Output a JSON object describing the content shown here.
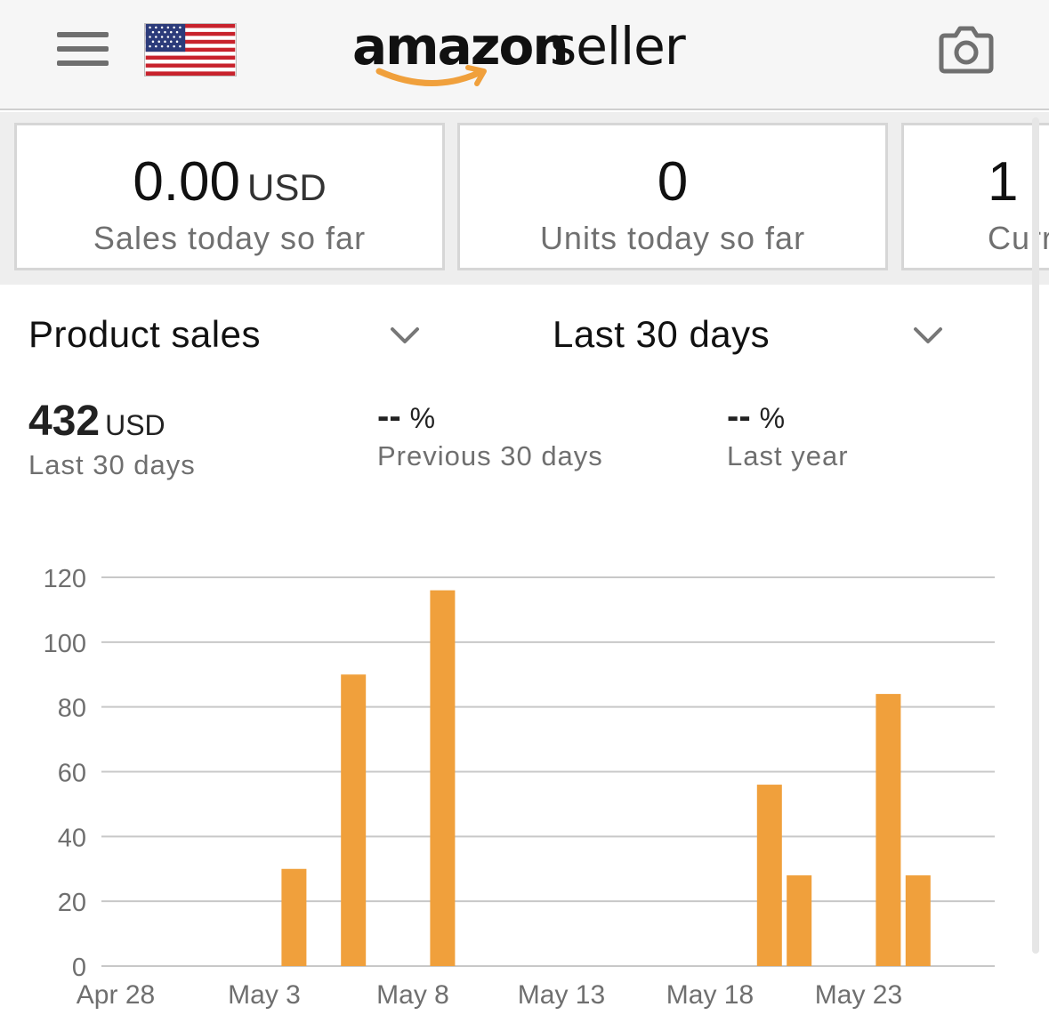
{
  "header": {
    "logo_primary": "amazon",
    "logo_secondary": "seller",
    "menu_icon": "hamburger-icon",
    "flag_icon": "us-flag-icon",
    "camera_icon": "camera-icon"
  },
  "cards": [
    {
      "value": "0.00",
      "unit": "USD",
      "label": "Sales today so far"
    },
    {
      "value": "0",
      "unit": "",
      "label": "Units today so far"
    },
    {
      "value": "1",
      "unit": "",
      "label": "Curr"
    }
  ],
  "selectors": {
    "metric": "Product sales",
    "range": "Last 30 days"
  },
  "metrics": {
    "total": {
      "value": "432",
      "unit": "USD",
      "label": "Last 30 days"
    },
    "previous": {
      "value": "--",
      "unit": "%",
      "label": "Previous 30 days"
    },
    "last_year": {
      "value": "--",
      "unit": "%",
      "label": "Last year"
    }
  },
  "colors": {
    "bar": "#f0a03c",
    "grid": "#c8c8c8",
    "axis_text": "#6f6f6f"
  },
  "chart_data": {
    "type": "bar",
    "title": "",
    "xlabel": "",
    "ylabel": "",
    "ylim": [
      0,
      120
    ],
    "y_ticks": [
      0,
      20,
      40,
      60,
      80,
      100,
      120
    ],
    "x_ticks": [
      "Apr 28",
      "May 3",
      "May 8",
      "May 13",
      "May 18",
      "May 23"
    ],
    "grid": true,
    "categories": [
      "Apr 28",
      "Apr 29",
      "Apr 30",
      "May 1",
      "May 2",
      "May 3",
      "May 4",
      "May 5",
      "May 6",
      "May 7",
      "May 8",
      "May 9",
      "May 10",
      "May 11",
      "May 12",
      "May 13",
      "May 14",
      "May 15",
      "May 16",
      "May 17",
      "May 18",
      "May 19",
      "May 20",
      "May 21",
      "May 22",
      "May 23",
      "May 24",
      "May 25",
      "May 26",
      "May 27"
    ],
    "values": [
      0,
      0,
      0,
      0,
      0,
      0,
      30,
      0,
      90,
      0,
      0,
      116,
      0,
      0,
      0,
      0,
      0,
      0,
      0,
      0,
      0,
      0,
      56,
      28,
      0,
      0,
      84,
      28,
      0,
      0
    ]
  }
}
